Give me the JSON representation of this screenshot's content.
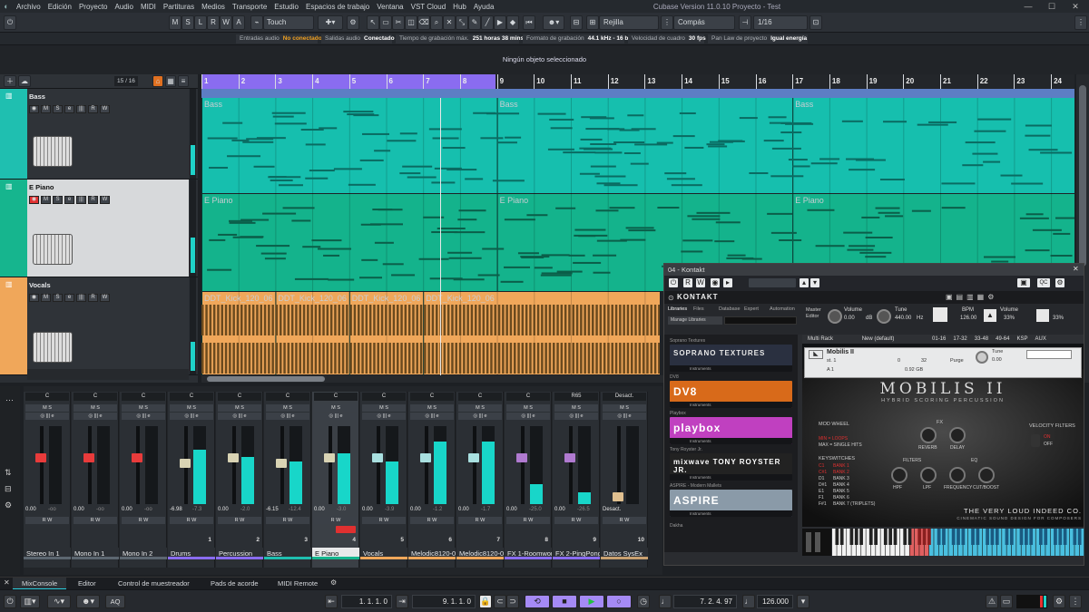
{
  "window": {
    "title": "Cubase Version 11.0.10 Proyecto - Test"
  },
  "menu": [
    "Archivo",
    "Edición",
    "Proyecto",
    "Audio",
    "MIDI",
    "Partituras",
    "Medios",
    "Transporte",
    "Estudio",
    "Espacios de trabajo",
    "Ventana",
    "VST Cloud",
    "Hub",
    "Ayuda"
  ],
  "toolbar": {
    "mode_buttons": [
      "M",
      "S",
      "L",
      "R",
      "W",
      "A"
    ],
    "automation_mode": "Touch",
    "snap_type": "Rejilla",
    "quantize_mode": "Compás",
    "quantize_value": "1/16"
  },
  "infobar": [
    {
      "label": "Entradas audio",
      "value": "No conectado",
      "warn": true
    },
    {
      "label": "Salidas audio",
      "value": "Conectado",
      "warn": false
    },
    {
      "label": "Tiempo de grabación máx.",
      "value": "251 horas 38 mins",
      "warn": false
    },
    {
      "label": "Formato de grabación",
      "value": "44.1 kHz - 16 bit",
      "warn": false
    },
    {
      "label": "Velocidad de cuadro",
      "value": "30 fps",
      "warn": false
    },
    {
      "label": "Pan Law de proyecto",
      "value": "Igual energía",
      "warn": false
    }
  ],
  "status": {
    "message": "Ningún objeto seleccionado"
  },
  "tracklist": {
    "count": "15 / 16",
    "tracks": [
      {
        "name": "Bass",
        "color": "#1fbfb0",
        "selected": false,
        "meter": 0.55
      },
      {
        "name": "E Piano",
        "color": "#16b58e",
        "selected": true,
        "meter": 0.6
      },
      {
        "name": "Vocals",
        "color": "#f0a75a",
        "selected": false,
        "meter": 0.5
      }
    ]
  },
  "ruler": {
    "bars": [
      "1",
      "2",
      "3",
      "4",
      "5",
      "6",
      "7",
      "8",
      "9",
      "10",
      "11",
      "12",
      "13",
      "14",
      "15",
      "16",
      "17",
      "18",
      "19",
      "20",
      "21",
      "22",
      "23",
      "24"
    ]
  },
  "lanes": [
    {
      "events": [
        {
          "label": "Bass",
          "bar": 1
        },
        {
          "label": "Bass",
          "bar": 9
        },
        {
          "label": "Bass",
          "bar": 17
        }
      ]
    },
    {
      "events": [
        {
          "label": "E Piano",
          "bar": 1
        },
        {
          "label": "E Piano",
          "bar": 9
        },
        {
          "label": "E Piano",
          "bar": 17
        }
      ]
    },
    {
      "events": [
        {
          "label": "DDT_Kick_120_06",
          "bar": 1
        },
        {
          "label": "DDT_Kick_120_06",
          "bar": 3
        },
        {
          "label": "DDT_Kick_120_06",
          "bar": 5
        },
        {
          "label": "DDT_Kick_120_06",
          "bar": 7
        }
      ]
    }
  ],
  "mixer": {
    "channels": [
      {
        "name": "Stereo In 1",
        "num": "",
        "color": "#5c6670",
        "fader_color": "#e83b3b",
        "fader": 0.35,
        "level": 0,
        "value": "0.00",
        "value2": "-oo",
        "top": "C"
      },
      {
        "name": "Mono In 1",
        "num": "",
        "color": "#5c6670",
        "fader_color": "#e83b3b",
        "fader": 0.35,
        "level": 0,
        "value": "0.00",
        "value2": "-oo",
        "top": "C"
      },
      {
        "name": "Mono In 2",
        "num": "",
        "color": "#5c6670",
        "fader_color": "#e83b3b",
        "fader": 0.35,
        "level": 0,
        "value": "0.00",
        "value2": "-oo",
        "top": "C"
      },
      {
        "name": "Drums",
        "num": "1",
        "color": "#8a6cf0",
        "fader_color": "#d9d4b4",
        "fader": 0.42,
        "level": 0.7,
        "value": "-6.98",
        "value2": "-7.3",
        "top": "C"
      },
      {
        "name": "Percussion",
        "num": "2",
        "color": "#8a6cf0",
        "fader_color": "#d9d4b4",
        "fader": 0.35,
        "level": 0.6,
        "value": "0.00",
        "value2": "-2.0",
        "top": "C"
      },
      {
        "name": "Bass",
        "num": "3",
        "color": "#1fbfb0",
        "fader_color": "#d9d4b4",
        "fader": 0.42,
        "level": 0.55,
        "value": "-6.15",
        "value2": "-12.4",
        "top": "C"
      },
      {
        "name": "E Piano",
        "num": "4",
        "color": "#16b58e",
        "fader_color": "#d9d4b4",
        "fader": 0.35,
        "level": 0.65,
        "value": "0.00",
        "value2": "-3.0",
        "top": "C",
        "selected": true
      },
      {
        "name": "Vocals",
        "num": "5",
        "color": "#f0a75a",
        "fader_color": "#a9e0e0",
        "fader": 0.35,
        "level": 0.55,
        "value": "0.00",
        "value2": "-3.9",
        "top": "C"
      },
      {
        "name": "Melodic8120-01",
        "num": "6",
        "color": "#f0a75a",
        "fader_color": "#a9e0e0",
        "fader": 0.35,
        "level": 0.8,
        "value": "0.00",
        "value2": "-1.2",
        "top": "C"
      },
      {
        "name": "Melodic8120-01",
        "num": "7",
        "color": "#f0a75a",
        "fader_color": "#a9e0e0",
        "fader": 0.35,
        "level": 0.8,
        "value": "0.00",
        "value2": "-1.7",
        "top": "C"
      },
      {
        "name": "FX 1-Roomworks SE",
        "num": "8",
        "color": "#8a6cf0",
        "fader_color": "#b07ad0",
        "fader": 0.35,
        "level": 0.25,
        "value": "0.00",
        "value2": "-25.0",
        "top": "C"
      },
      {
        "name": "FX 2-PingPongDelay",
        "num": "9",
        "color": "#8a6cf0",
        "fader_color": "#b07ad0",
        "fader": 0.35,
        "level": 0.15,
        "value": "0.00",
        "value2": "-26.5",
        "top": "R65"
      },
      {
        "name": "Datos SysEx",
        "num": "10",
        "color": "#c8a070",
        "fader_color": "#e0c090",
        "fader": 0.85,
        "level": 0,
        "value": "Desact.",
        "value2": "",
        "top": "Desact."
      }
    ]
  },
  "kontakt": {
    "title": "04 - Kontakt",
    "brand": "KONTAKT",
    "tabs": [
      "Libraries",
      "Files",
      "Database",
      "Expert",
      "Automation"
    ],
    "search_placeholder": "Manage Libraries",
    "libraries": [
      {
        "section": "Soprano Textures",
        "label": "SOPRANO TEXTURES",
        "bg": "#2a3040",
        "fg": "#e8e8e8"
      },
      {
        "section": "DV8",
        "label": "DV8",
        "bg": "#d86a1a",
        "fg": "#fff"
      },
      {
        "section": "Playbox",
        "label": "playbox",
        "bg": "#c040c0",
        "fg": "#fff"
      },
      {
        "section": "Tony Royster Jr.",
        "label": "mixwave  TONY ROYSTER JR.",
        "bg": "#222",
        "fg": "#fff"
      },
      {
        "section": "ASPIRE - Modern Mallets",
        "label": "ASPIRE",
        "bg": "#8a9aa8",
        "fg": "#fff"
      }
    ],
    "instrument_sub": "Instruments",
    "bottom_section": "Dakha",
    "rack": {
      "label": "Multi Rack",
      "preset": "New (default)",
      "tabs": [
        "01-16",
        "17-32",
        "33-48",
        "49-64",
        "KSP",
        "AUX"
      ]
    },
    "master": {
      "volume_label": "Volume",
      "volume": "0.00",
      "volume_unit": "dB",
      "tune_label": "Tune",
      "tune": "440.00",
      "tune_unit": "Hz",
      "bpm_label": "BPM",
      "bpm": "126.00",
      "vol2_label": "Volume",
      "vol2": "33%",
      "vol3": "33%",
      "cpu": "0%",
      "disk": "0%"
    },
    "instrument": {
      "name": "Mobilis II",
      "title": "MOBILIS II",
      "subtitle": "HYBRID SCORING PERCUSSION",
      "output": "st. 1",
      "voices": "0",
      "max_voices": "32",
      "midi": "A 1",
      "memory": "0.92 GB",
      "purge": "Purge",
      "tune_label": "Tune",
      "tune": "0.00",
      "labels": {
        "mod_wheel": "MOD WHEEL",
        "fx": "FX",
        "reverb": "REVERB",
        "delay": "DELAY",
        "velocity": "VELOCITY FILTERS",
        "on": "ON",
        "off": "OFF",
        "keyswitches": "KEYSWITCHES",
        "filters": "FILTERS",
        "eq": "EQ",
        "hpf": "HPF",
        "lpf": "LPF",
        "frequency": "FREQUENCY",
        "cutboost": "CUT/BOOST"
      },
      "mod_options": [
        "MIN = LOOPS",
        "MAX = SINGLE HITS"
      ],
      "keyswitches": [
        [
          "C1",
          "BANK 1"
        ],
        [
          "C#1",
          "BANK 2"
        ],
        [
          "D1",
          "BANK 3"
        ],
        [
          "D#1",
          "BANK 4"
        ],
        [
          "E1",
          "BANK 5"
        ],
        [
          "F1",
          "BANK 6"
        ],
        [
          "F#1",
          "BANK 7 (TRIPLETS)"
        ]
      ],
      "vendor": "THE VERY LOUD INDEED CO.",
      "vendor_sub": "CINEMATIC SOUND DESIGN FOR COMPOSERS"
    }
  },
  "bottom_tabs": [
    "MixConsole",
    "Editor",
    "Control de muestreador",
    "Pads de acorde",
    "MIDI Remote"
  ],
  "transport": {
    "left_locator": "1. 1. 1.   0",
    "right_locator": "9. 1. 1.   0",
    "position": "7. 2. 4.  97",
    "tempo": "126.000",
    "aq": "AQ"
  }
}
